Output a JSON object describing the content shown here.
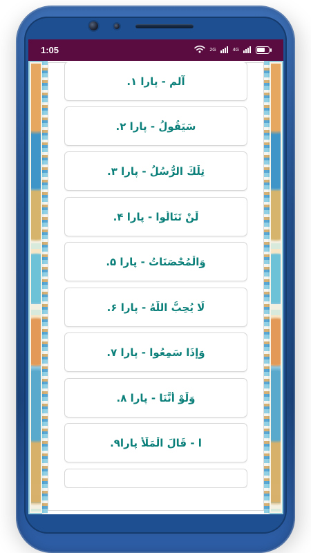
{
  "status_bar": {
    "time": "1:05",
    "network_label_1": "2G",
    "network_label_2": "4G"
  },
  "list": {
    "items": [
      {
        "label": "آلم - پارا ۱."
      },
      {
        "label": "سَیَقُولُ - پارا ۲."
      },
      {
        "label": "تِلْكَ الرُّسُلُ - پارا ۳."
      },
      {
        "label": "لَنْ تَنَالُوا - پارا ۴."
      },
      {
        "label": "وَالْمُحْصَنَاتُ - پارا ۵."
      },
      {
        "label": "لَا يُحِبُّ اللّٰهُ - پارا ۶."
      },
      {
        "label": "وَإِذَا سَمِعُوا - پارا ۷."
      },
      {
        "label": "وَلَوْ أَنَّنَا - پارا ۸."
      },
      {
        "label": "ا - قَالَ الْمَلَأُ پارا۹."
      }
    ]
  }
}
